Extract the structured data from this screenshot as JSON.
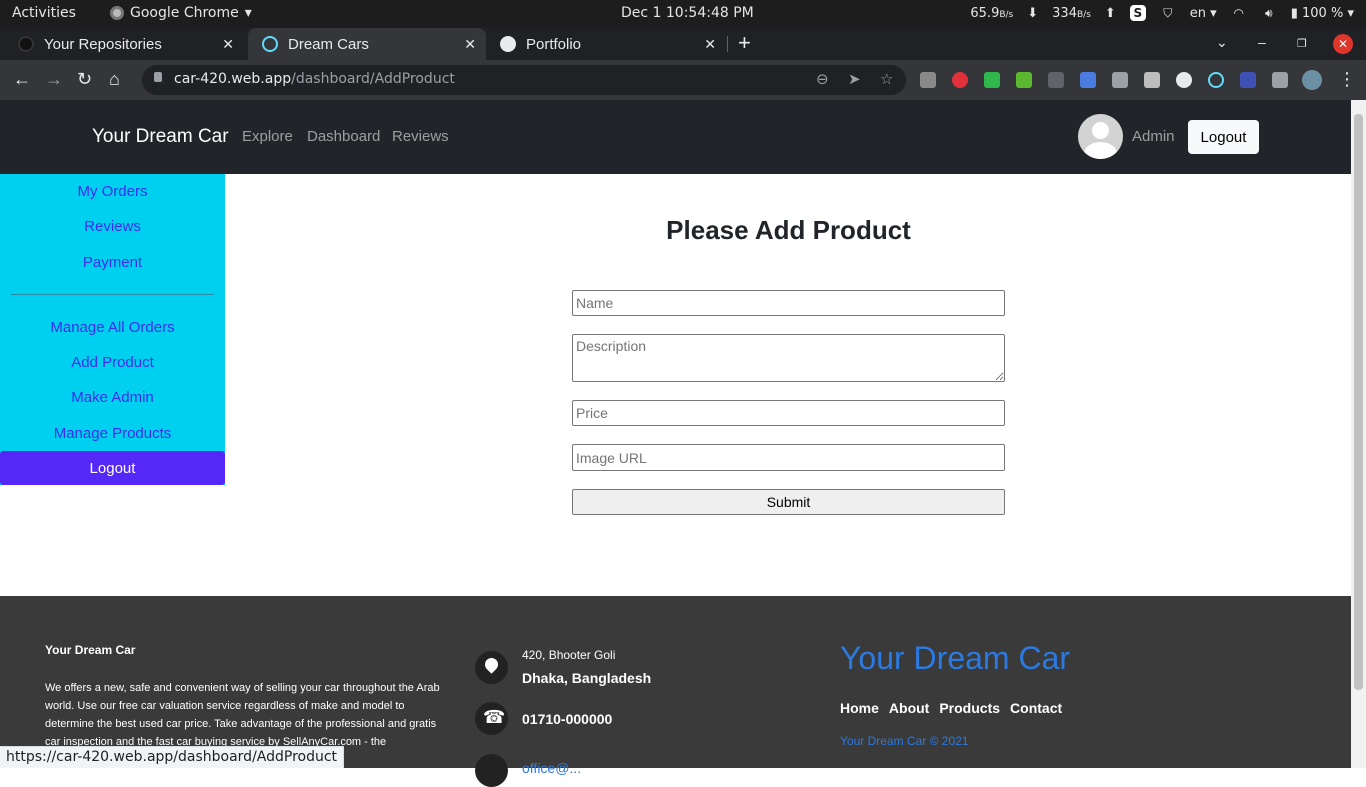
{
  "gnome": {
    "activities": "Activities",
    "app_name": "Google Chrome",
    "clock": "Dec 1  10:54:48 PM",
    "net_down": "65.9",
    "net_down_unit": "B/s",
    "net_up": "334",
    "net_up_unit": "B/s",
    "lang": "en",
    "battery": "100 %"
  },
  "browser": {
    "tabs": [
      {
        "label": "Your Repositories",
        "close": "✕"
      },
      {
        "label": "Dream Cars",
        "close": "✕"
      },
      {
        "label": "Portfolio",
        "close": "✕"
      }
    ],
    "new_tab": "+",
    "url_host": "car-420.web.app",
    "url_path": "/dashboard/AddProduct",
    "status_url": "https://car-420.web.app/dashboard/AddProduct"
  },
  "header": {
    "brand": "Your Dream Car",
    "nav": [
      "Explore",
      "Dashboard",
      "Reviews"
    ],
    "user": "Admin",
    "logout": "Logout"
  },
  "sidebar": {
    "items": [
      "My Orders",
      "Reviews",
      "Payment"
    ],
    "admin_items": [
      "Manage All Orders",
      "Add Product",
      "Make Admin",
      "Manage Products"
    ],
    "logout": "Logout"
  },
  "form": {
    "title": "Please Add Product",
    "name_placeholder": "Name",
    "description_placeholder": "Description",
    "price_placeholder": "Price",
    "image_placeholder": "Image URL",
    "submit": "Submit"
  },
  "footer": {
    "title": "Your Dream Car",
    "description": "We offers a new, safe and convenient way of selling your car throughout the Arab world. Use our free car valuation service regardless of make and model to determine the best used car price. Take advantage of the professional and gratis car inspection and the fast car buying service by SellAnyCar.com - the",
    "address_line1": "420, Bhooter Goli",
    "address_line2": "Dhaka, Bangladesh",
    "phone": "01710-000000",
    "email": "office@...",
    "brand": "Your Dream Car",
    "links": [
      "Home",
      "About",
      "Products",
      "Contact"
    ],
    "copyright": "Your Dream Car © 2021"
  },
  "colors": {
    "header_bg": "#212529",
    "sidebar_bg": "#00d0f0",
    "sidebar_link": "#3d2cf0",
    "sidebar_logout": "#5528f8",
    "footer_bg": "#3a3a3a",
    "footer_accent": "#2a7ae2"
  }
}
